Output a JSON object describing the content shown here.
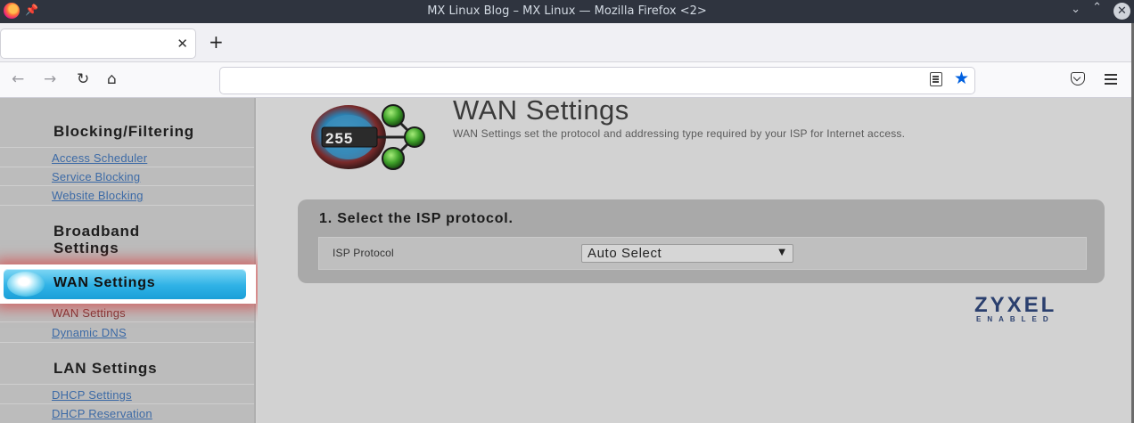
{
  "window": {
    "title": "MX Linux Blog – MX Linux — Mozilla Firefox <2>"
  },
  "tabs": [
    {
      "label": ""
    }
  ],
  "urlbar": {
    "value": ""
  },
  "sidebar": {
    "groups": [
      {
        "heading": "Blocking/Filtering",
        "links": [
          "Access Scheduler",
          "Service Blocking",
          "Website Blocking"
        ]
      },
      {
        "heading": "Broadband Settings",
        "active_button": "WAN Settings",
        "links": [
          "WAN Settings",
          "Dynamic DNS"
        ]
      },
      {
        "heading": "LAN Settings",
        "links": [
          "DHCP Settings",
          "DHCP Reservation"
        ]
      }
    ]
  },
  "main": {
    "logo_number": "255",
    "title": "WAN Settings",
    "description": "WAN Settings set the protocol and addressing type required by your ISP for Internet access.",
    "panel": {
      "title": "1. Select the ISP protocol.",
      "field_label": "ISP Protocol",
      "field_value": "Auto Select"
    },
    "brand": {
      "name": "ZYXEL",
      "tagline": "ENABLED"
    }
  },
  "colors": {
    "highlight_glow": "#dc2828",
    "active_button": "#2fb2e6",
    "link": "#3c6aa6",
    "brand": "#2a3f6e",
    "bookmark_star": "#0060df"
  }
}
